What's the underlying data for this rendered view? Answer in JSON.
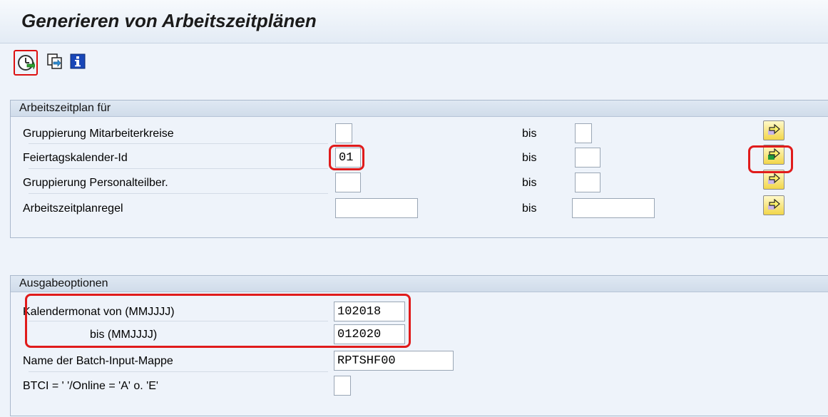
{
  "title": "Generieren von Arbeitszeitplänen",
  "toolbar": {
    "execute_icon": "execute-clock-icon",
    "variant_icon": "get-variant-icon",
    "info_icon": "program-info-icon"
  },
  "block1": {
    "title": "Arbeitszeitplan für",
    "rows": [
      {
        "label": "Gruppierung Mitarbeiterkreise",
        "from": "",
        "bis": "bis",
        "to": ""
      },
      {
        "label": "Feiertagskalender-Id",
        "from": "01",
        "bis": "bis",
        "to": ""
      },
      {
        "label": "Gruppierung Personalteilber.",
        "from": "",
        "bis": "bis",
        "to": ""
      },
      {
        "label": "Arbeitszeitplanregel",
        "from": "",
        "bis": "bis",
        "to": ""
      }
    ]
  },
  "block2": {
    "title": "Ausgabeoptionen",
    "rows": [
      {
        "label": "Kalendermonat von (MMJJJJ)",
        "value": "102018"
      },
      {
        "label": "bis (MMJJJJ)",
        "value": "012020"
      },
      {
        "label": "Name der Batch-Input-Mappe",
        "value": "RPTSHF00"
      },
      {
        "label": "BTCI = ' '/Online = 'A' o. 'E'",
        "value": ""
      }
    ]
  },
  "colors": {
    "highlight": "#e01b1b",
    "button_yellow": "#f2d64a",
    "background": "#eef3fa"
  }
}
